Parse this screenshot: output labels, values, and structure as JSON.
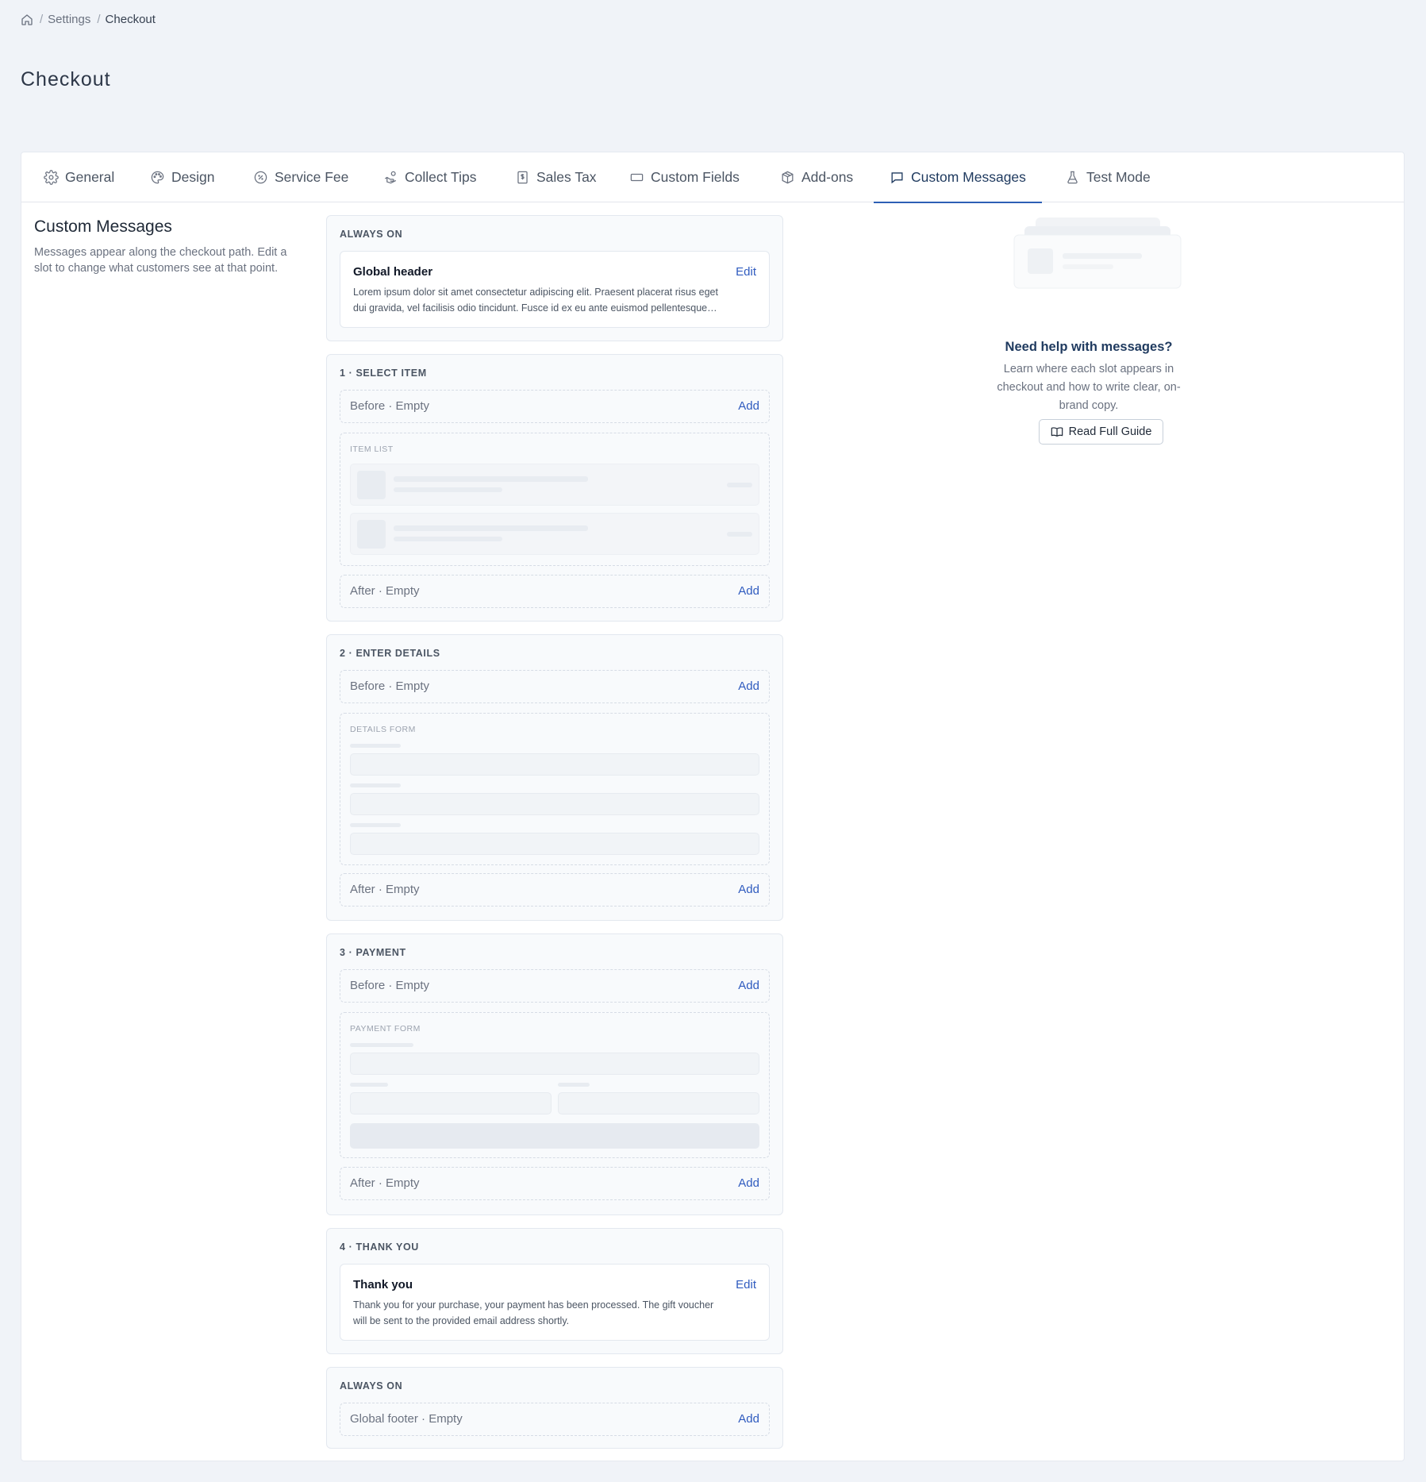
{
  "breadcrumb": {
    "items": [
      "Settings",
      "Checkout"
    ],
    "separator": "/"
  },
  "page": {
    "title": "Checkout"
  },
  "tabs": [
    {
      "label": "General",
      "icon": "gear-icon"
    },
    {
      "label": "Design",
      "icon": "palette-icon"
    },
    {
      "label": "Service Fee",
      "icon": "percent-badge-icon"
    },
    {
      "label": "Collect Tips",
      "icon": "hand-coins-icon"
    },
    {
      "label": "Sales Tax",
      "icon": "receipt-dollar-icon"
    },
    {
      "label": "Custom Fields",
      "icon": "text-field-icon"
    },
    {
      "label": "Add-ons",
      "icon": "package-icon"
    },
    {
      "label": "Custom Messages",
      "icon": "message-square-icon",
      "active": true
    },
    {
      "label": "Test Mode",
      "icon": "flask-icon"
    }
  ],
  "sidebar": {
    "title": "Custom Messages",
    "description": "Messages appear along the checkout path. Edit a slot to change what customers see at that point."
  },
  "sections": {
    "header": {
      "label": "ALWAYS ON",
      "title": "Global header",
      "action": "Edit",
      "text_line1": "Lorem ipsum dolor sit amet consectetur adipiscing elit. Praesent placerat risus eget",
      "text_line2": "dui gravida, vel facilisis odio tincidunt. Fusce id ex eu ante euismod pellentesque…"
    },
    "select_item": {
      "label": "1 · SELECT ITEM",
      "before": "Before · Empty",
      "after": "After · Empty",
      "action": "Add",
      "preview_label": "ITEM LIST"
    },
    "enter_details": {
      "label": "2 · ENTER DETAILS",
      "before": "Before · Empty",
      "after": "After · Empty",
      "action": "Add",
      "preview_label": "DETAILS FORM"
    },
    "payment": {
      "label": "3 · PAYMENT",
      "before": "Before · Empty",
      "after": "After · Empty",
      "action": "Add",
      "preview_label": "PAYMENT FORM"
    },
    "thank_you": {
      "label": "4 · THANK YOU",
      "title": "Thank you",
      "action": "Edit",
      "text_line1": "Thank you for your purchase, your payment has been processed. The gift voucher",
      "text_line2": "will be sent to the provided email address shortly."
    },
    "footer": {
      "label": "ALWAYS ON",
      "slot": "Global footer · Empty",
      "action": "Add"
    }
  },
  "help": {
    "title": "Need help with messages?",
    "description": "Learn where each slot appears in checkout and how to write clear, on-brand copy.",
    "button": "Read Full Guide",
    "button_icon": "book-open-icon"
  },
  "colors": {
    "accent": "#2f5bbf",
    "active_tab": "#1f3a5f",
    "page_bg": "#f0f3f8"
  }
}
